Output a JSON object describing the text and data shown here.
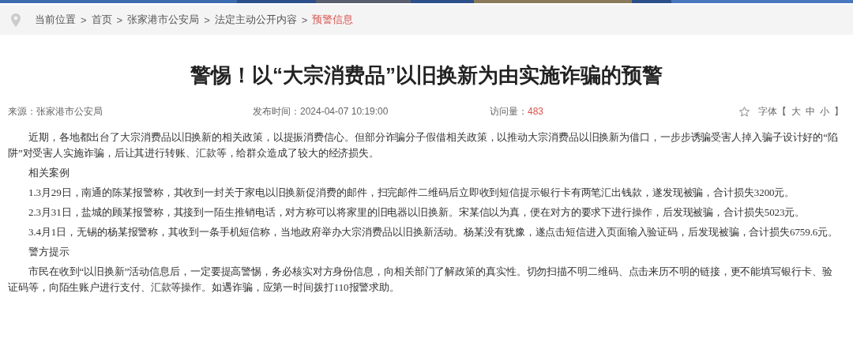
{
  "breadcrumb": {
    "items": [
      {
        "label": "当前位置",
        "current": false
      },
      {
        "label": "首页",
        "current": false
      },
      {
        "label": "张家港市公安局",
        "current": false
      },
      {
        "label": "法定主动公开内容",
        "current": false
      },
      {
        "label": "预警信息",
        "current": true
      }
    ],
    "separator": ">"
  },
  "title": "警惕！以“大宗消费品”以旧换新为由实施诈骗的预警",
  "meta": {
    "source": "来源：张家港市公安局",
    "published": "发布时间：2024-04-07 10:19:00",
    "views_label": "访问量：",
    "views": "483",
    "font_label": "字体【",
    "font_options": [
      "大",
      "中",
      "小"
    ],
    "font_close": "】"
  },
  "body": [
    "近期，各地都出台了大宗消费品以旧换新的相关政策，以提振消费信心。但部分诈骗分子假借相关政策，以推动大宗消费品以旧换新为借口，一步步诱骗受害人掉入骗子设计好的“陷阱”对受害人实施诈骗，后让其进行转账、汇款等，给群众造成了较大的经济损失。",
    "相关案例",
    "1.3月29日，南通的陈某报警称，其收到一封关于家电以旧换新促消费的邮件，扫完邮件二维码后立即收到短信提示银行卡有两笔汇出钱款，遂发现被骗，合计损失3200元。",
    "2.3月31日，盐城的顾某报警称，其接到一陌生推销电话，对方称可以将家里的旧电器以旧换新。宋某信以为真，便在对方的要求下进行操作，后发现被骗，合计损失5023元。",
    "3.4月1日，无锡的杨某报警称，其收到一条手机短信称，当地政府举办大宗消费品以旧换新活动。杨某没有犹豫，遂点击短信进入页面输入验证码，后发现被骗，合计损失6759.6元。",
    "警方提示",
    "市民在收到“以旧换新”活动信息后，一定要提高警惕，务必核实对方身份信息，向相关部门了解政策的真实性。切勿扫描不明二维码、点击来历不明的链接，更不能填写银行卡、验证码等，向陌生账户进行支付、汇款等操作。如遇诈骗，应第一时间拨打110报警求助。"
  ]
}
